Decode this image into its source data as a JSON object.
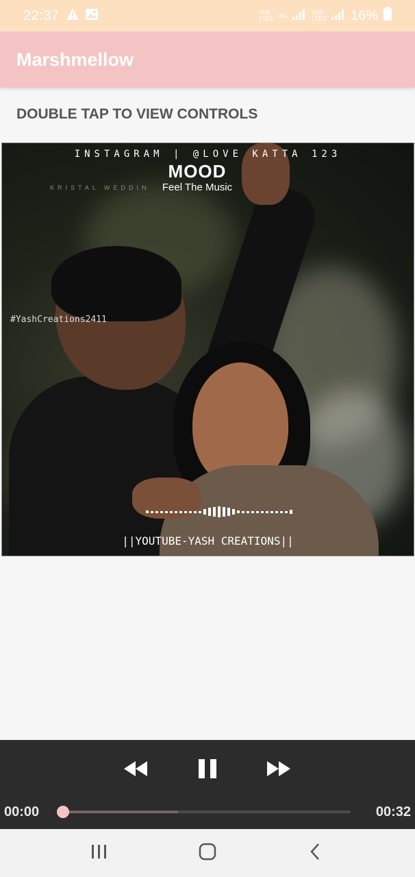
{
  "status_bar": {
    "time": "22:37",
    "sim1": "VoB\nLTE1",
    "net4g": "4G",
    "sim2": "VoB\nLTE2",
    "battery": "16%",
    "icons": [
      "warning-icon",
      "image-icon",
      "signal-icon",
      "battery-icon"
    ]
  },
  "app_bar": {
    "title": "Marshmellow",
    "color": "#f4c4c4"
  },
  "hint": "DOUBLE TAP TO VIEW CONTROLS",
  "video": {
    "overlay_instagram": "INSTAGRAM | @LOVE KATTA 123",
    "overlay_mood": "MOOD",
    "overlay_feel": "Feel The Music",
    "overlay_kristal": "KRISTAL WEDDIN",
    "overlay_tag": "#YashCreations2411",
    "overlay_youtube": "||YOUTUBE-YASH CREATIONS||"
  },
  "player": {
    "current_time": "00:00",
    "duration": "00:32",
    "progress_fraction": 0.0,
    "buffered_fraction": 0.4,
    "icons": [
      "rewind-icon",
      "pause-icon",
      "fast-forward-icon"
    ]
  },
  "nav_bar": {
    "icons": [
      "recents-icon",
      "home-icon",
      "back-icon"
    ]
  }
}
